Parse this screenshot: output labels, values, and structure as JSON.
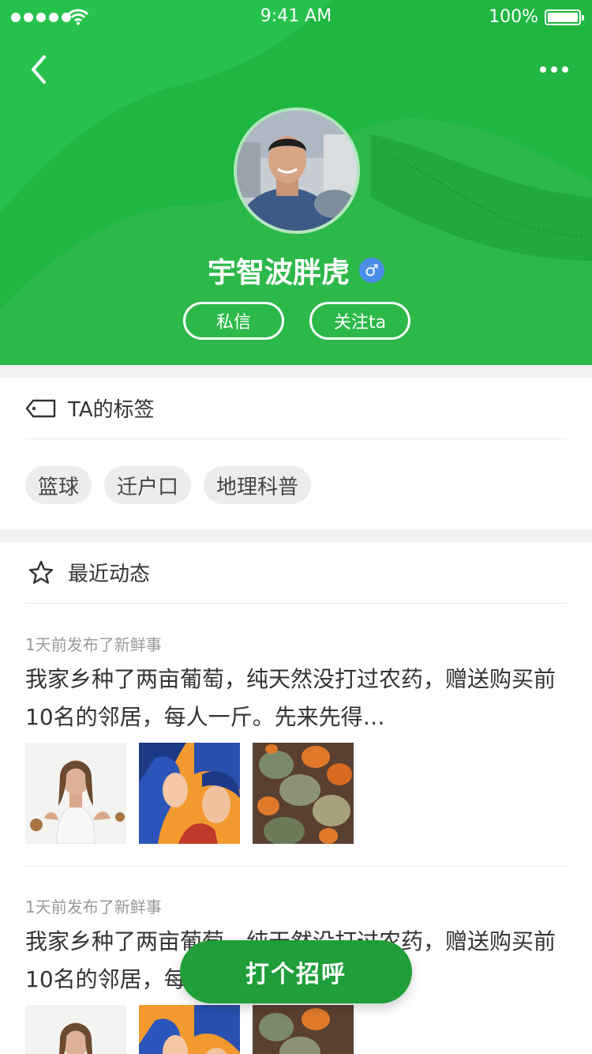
{
  "status_bar": {
    "time": "9:41 AM",
    "battery": "100%"
  },
  "profile": {
    "name": "宇智波胖虎",
    "gender_symbol": "♂",
    "message_label": "私信",
    "follow_label": "关注ta"
  },
  "tags_section": {
    "title": "TA的标签",
    "tags": [
      "篮球",
      "迁户口",
      "地理科普"
    ]
  },
  "feed_section": {
    "title": "最近动态",
    "posts": [
      {
        "meta": "1天前发布了新鲜事",
        "text": "我家乡种了两亩葡萄，纯天然没打过农药，赠送购买前10名的邻居，每人一斤。先来先得…"
      },
      {
        "meta": "1天前发布了新鲜事",
        "text": "我家乡种了两亩葡萄，纯天然没打过农药，赠送购买前10名的邻居，每人一斤。先来先得…"
      }
    ]
  },
  "cta": {
    "label": "打个招呼"
  },
  "colors": {
    "header_green": "#22b845",
    "button_green": "#1f9e3a",
    "gender_blue": "#4a8ee8"
  }
}
